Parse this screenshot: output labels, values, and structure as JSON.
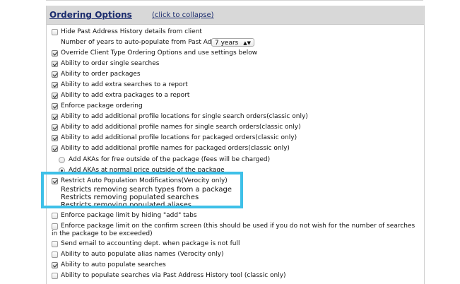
{
  "section": {
    "title": "Ordering Options",
    "collapse_link": "(click to collapse)"
  },
  "hide_past_address": {
    "label": "Hide Past Address History details from client",
    "checked": false
  },
  "years_row": {
    "label": "Number of years to auto-populate from Past Address History",
    "select_value": "7 years"
  },
  "options": [
    {
      "label": "Override Client Type Ordering Options and use settings below",
      "checked": true
    },
    {
      "label": "Ability to order single searches",
      "checked": true
    },
    {
      "label": "Ability to order packages",
      "checked": true
    },
    {
      "label": "Ability to add extra searches to a report",
      "checked": true
    },
    {
      "label": "Ability to add extra packages to a report",
      "checked": true
    },
    {
      "label": "Enforce package ordering",
      "checked": true
    },
    {
      "label": "Ability to add additional profile locations for single search orders(classic only)",
      "checked": true
    },
    {
      "label": "Ability to add additional profile names for single search orders(classic only)",
      "checked": true
    },
    {
      "label": "Ability to add additional profile locations for packaged orders(classic only)",
      "checked": true
    },
    {
      "label": "Ability to add additional profile names for packaged orders(classic only)",
      "checked": true
    }
  ],
  "akas": [
    {
      "label": "Add AKAs for free outside of the package (fees will be charged)",
      "selected": false
    },
    {
      "label": "Add AKAs at normal price outside of the package",
      "selected": true
    }
  ],
  "restrict": {
    "label": "Restrict Auto Population Modifications(Verocity only)",
    "checked": true,
    "details": [
      "Restricts removing search types from a package",
      "Restricts removing populated searches",
      "Restricts removing populated aliases"
    ]
  },
  "enforce_hiding": {
    "label": "Enforce package limit by hiding \"add\" tabs",
    "checked": false
  },
  "enforce_confirm": {
    "line1": "Enforce package limit on the confirm screen (this should be used if you do not wish for the number of searches",
    "line2": "in the package to be exceeded)",
    "checked": false
  },
  "bottom_options": [
    {
      "label": "Send email to accounting dept. when package is not full",
      "checked": false
    },
    {
      "label": "Ability to auto populate alias names (Verocity only)",
      "checked": false
    },
    {
      "label": "Ability to auto populate searches",
      "checked": true
    },
    {
      "label": "Ability to populate searches via Past Address History tool (classic only)",
      "checked": false
    }
  ],
  "colors": {
    "header_bg": "#d8d8d8",
    "title": "#1b2c6e",
    "highlight": "#3ec0e8"
  }
}
